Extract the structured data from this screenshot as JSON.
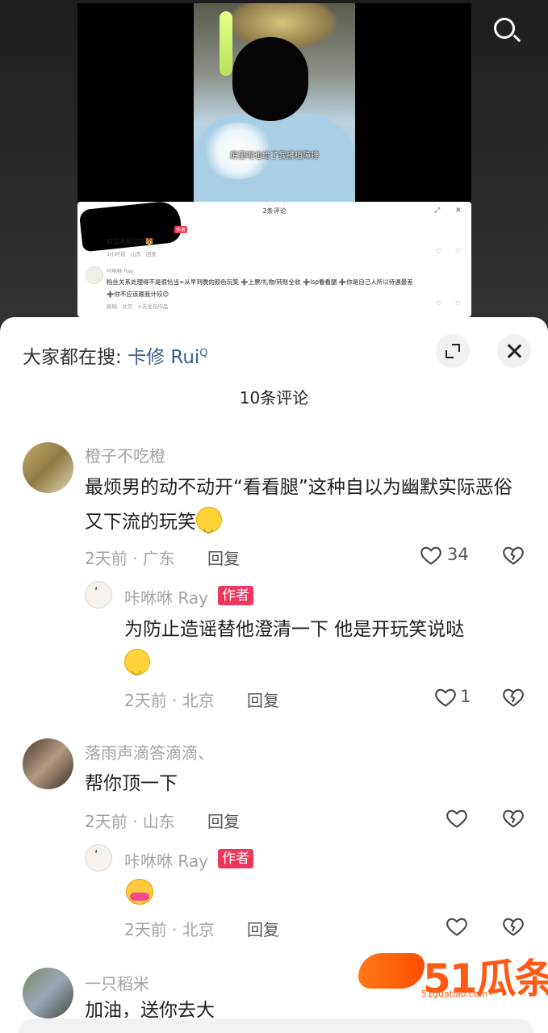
{
  "video": {
    "subtitle": "厉里呢也给了我拂植障排"
  },
  "mini_panel": {
    "title": "2条评论",
    "c1_text": "欢迎老板回来🐯",
    "c1_meta": "1小时前 · 山东",
    "c1_reply": "回复",
    "author_badge": "作者",
    "c2_user": "咔咻咻 Ray",
    "c2_line1": "粉丝关系处理得不是很恰当=从早到晚的颜色玩笑 ➕上票/礼物/转账全收 ➕lsp看看腿 ➕你是自己人所以待遇最差",
    "c2_line2": "➕你不应该跟我计较😊",
    "c2_meta": "刚刚 · 北京",
    "c2_action": "⊙去发布作品"
  },
  "sheet": {
    "hot_label": "大家都在搜: ",
    "hot_keyword": "卡修 Rui",
    "hot_search_glyph": "Q",
    "comment_count": "10条评论"
  },
  "comments": [
    {
      "user": "橙子不吃橙",
      "text": "最烦男的动不动开“看看腿”这种自以为幽默实际恶俗又下流的玩笑",
      "meta": "2天前 · 广东",
      "reply": "回复",
      "likes": "34"
    },
    {
      "user": "咔咻咻 Ray",
      "badge": "作者",
      "text": "为防止造谣替他澄清一下 他是开玩笑说哒",
      "meta": "2天前 · 北京",
      "reply": "回复",
      "likes": "1"
    },
    {
      "user": "落雨声滴答滴滴、",
      "text": "帮你顶一下",
      "meta": "2天前 · 山东",
      "reply": "回复"
    },
    {
      "user": "咔咻咻 Ray",
      "badge": "作者",
      "meta": "2天前 · 北京",
      "reply": "回复"
    },
    {
      "user": "一只稻米",
      "text": "加油，送你去大"
    }
  ],
  "watermark": {
    "brand": "51瓜条",
    "url": "51guatiao.com"
  },
  "colors": {
    "author_badge": "#f0355c",
    "keyword": "#3a5f8c",
    "watermark": "#ff5a14"
  }
}
